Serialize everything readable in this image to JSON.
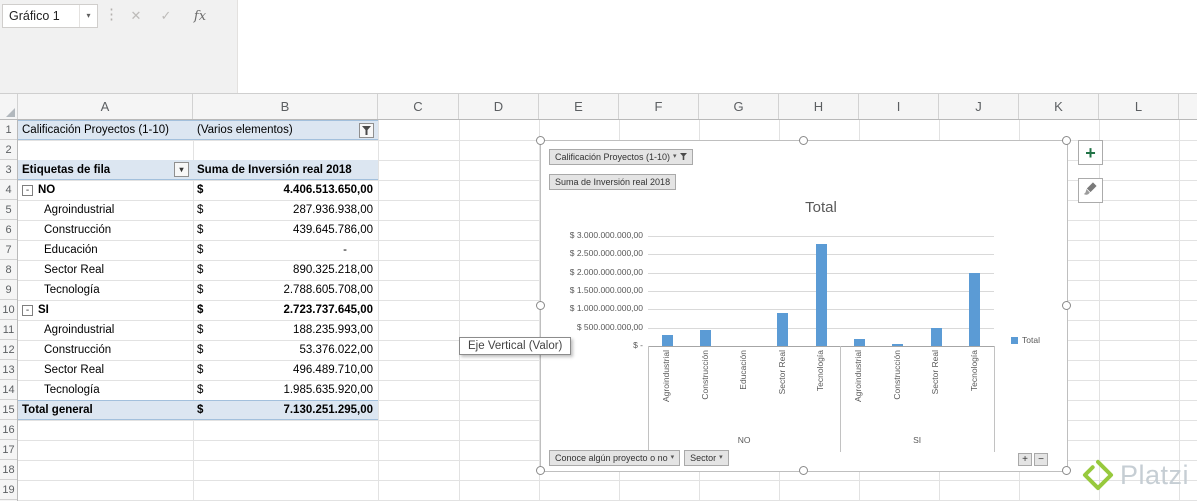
{
  "name_box": {
    "value": "Gráfico 1"
  },
  "formula_bar": {
    "dots": "⋮",
    "cancel": "✕",
    "enter": "✓",
    "fx": "fx"
  },
  "icons": {
    "plus": "+"
  },
  "sheet": {
    "columns": [
      "A",
      "B",
      "C",
      "D",
      "E",
      "F",
      "G",
      "H",
      "I",
      "J",
      "K",
      "L"
    ],
    "row_numbers": [
      1,
      2,
      3,
      4,
      5,
      6,
      7,
      8,
      9,
      10,
      11,
      12,
      13,
      14,
      15,
      16,
      17,
      18,
      19
    ]
  },
  "pivot": {
    "filter_field": "Calificación Proyectos (1-10)",
    "filter_value": "(Varios elementos)",
    "row_labels_header": "Etiquetas de fila",
    "values_header": "Suma de Inversión real 2018",
    "currency_symbol": "$",
    "rows": [
      {
        "label": "NO",
        "type": "group",
        "value": "4.406.513.650,00"
      },
      {
        "label": "Agroindustrial",
        "type": "item",
        "value": "287.936.938,00"
      },
      {
        "label": "Construcción",
        "type": "item",
        "value": "439.645.786,00"
      },
      {
        "label": "Educación",
        "type": "item",
        "value": "-"
      },
      {
        "label": "Sector Real",
        "type": "item",
        "value": "890.325.218,00"
      },
      {
        "label": "Tecnología",
        "type": "item",
        "value": "2.788.605.708,00"
      },
      {
        "label": "SI",
        "type": "group",
        "value": "2.723.737.645,00"
      },
      {
        "label": "Agroindustrial",
        "type": "item",
        "value": "188.235.993,00"
      },
      {
        "label": "Construcción",
        "type": "item",
        "value": "53.376.022,00"
      },
      {
        "label": "Sector Real",
        "type": "item",
        "value": "496.489.710,00"
      },
      {
        "label": "Tecnología",
        "type": "item",
        "value": "1.985.635.920,00"
      },
      {
        "label": "Total general",
        "type": "total",
        "value": "7.130.251.295,00"
      }
    ]
  },
  "chart": {
    "filter_button": "Calificación Proyectos (1-10)",
    "value_button": "Suma de Inversión real 2018",
    "axis_buttons": [
      "Conoce algún proyecto o no",
      "Sector"
    ],
    "expand_collapse": [
      "+",
      "−"
    ],
    "tooltip": "Eje Vertical (Valor)"
  },
  "chart_data": {
    "type": "bar",
    "title": "Total",
    "xlabel": "",
    "ylabel": "",
    "ylim": [
      0,
      3000000000
    ],
    "ytick_labels": [
      "$ -",
      "$ 500.000.000,00",
      "$ 1.000.000.000,00",
      "$ 1.500.000.000,00",
      "$ 2.000.000.000,00",
      "$ 2.500.000.000,00",
      "$ 3.000.000.000,00"
    ],
    "grid": true,
    "legend": [
      "Total"
    ],
    "legend_position": "right",
    "bar_color": "#5B9BD5",
    "groups": [
      {
        "label": "NO",
        "categories": [
          "Agroindustrial",
          "Construcción",
          "Educación",
          "Sector Real",
          "Tecnología"
        ],
        "values": [
          287936938,
          439645786,
          0,
          890325218,
          2788605708
        ]
      },
      {
        "label": "SI",
        "categories": [
          "Agroindustrial",
          "Construcción",
          "Sector Real",
          "Tecnología"
        ],
        "values": [
          188235993,
          53376022,
          496489710,
          1985635920
        ]
      }
    ]
  },
  "branding": {
    "logo_text": "Platzi",
    "logo_color": "#97C93D"
  }
}
